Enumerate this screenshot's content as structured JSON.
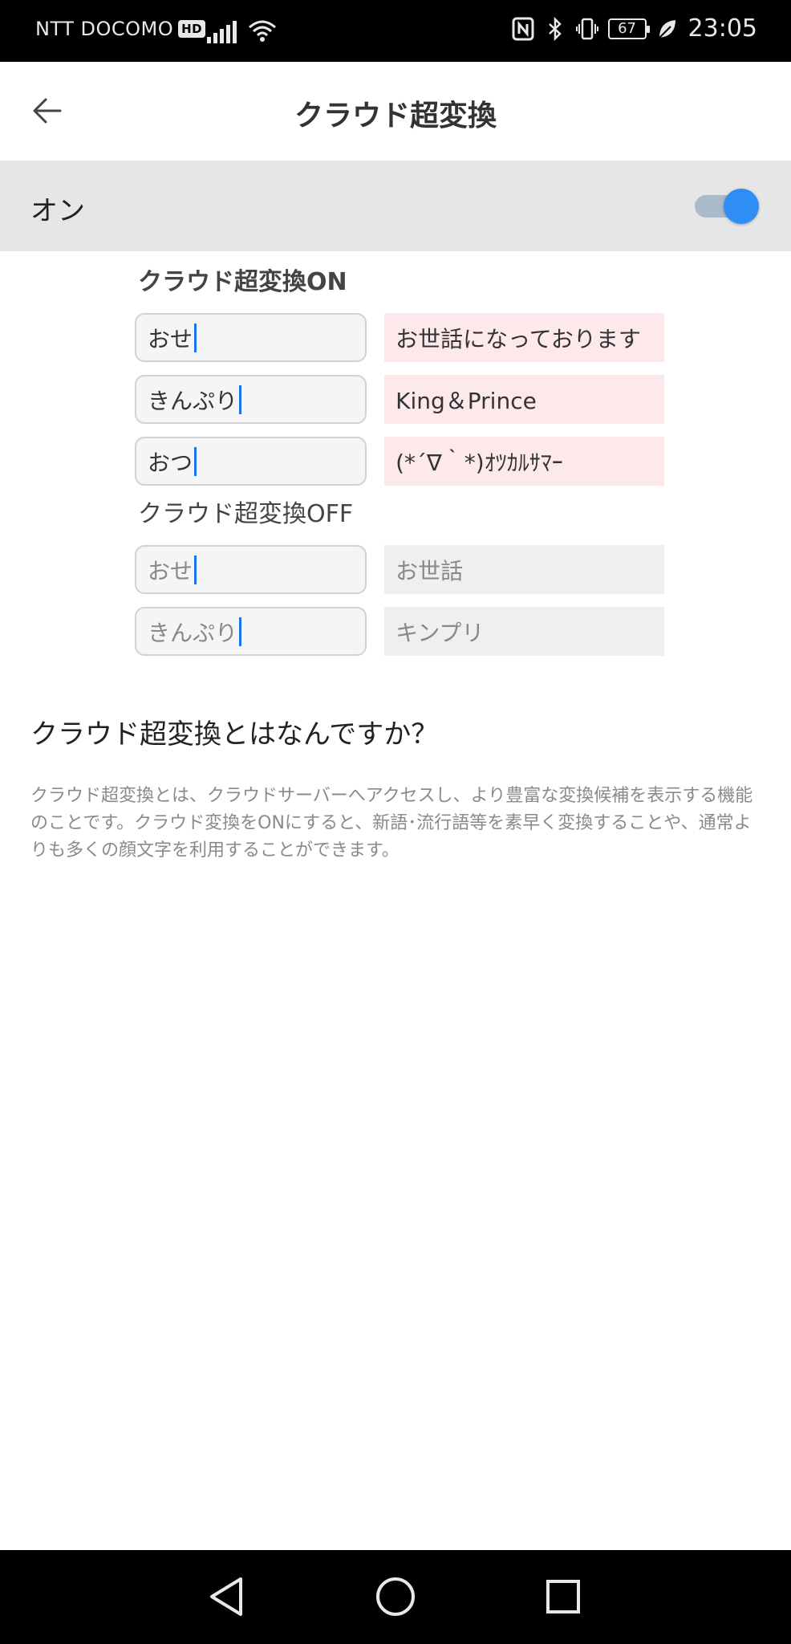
{
  "status_bar": {
    "carrier": "NTT DOCOMO",
    "hd_badge": "HD",
    "battery": "67",
    "time": "23:05"
  },
  "app_bar": {
    "title": "クラウド超変換",
    "back_icon": "arrow-left-icon"
  },
  "toggle": {
    "label": "オン",
    "state": "on",
    "accent_color": "#2f8ef5"
  },
  "demo": {
    "on_heading": "クラウド超変換ON",
    "on_rows": [
      {
        "input": "おせ",
        "result": "お世話になっております"
      },
      {
        "input": "きんぷり",
        "result": "King＆Prince"
      },
      {
        "input": "おつ",
        "result": "(*´∇｀*)ｵﾂｶﾙｻﾏｰ"
      }
    ],
    "off_heading": "クラウド超変換OFF",
    "off_rows": [
      {
        "input": "おせ",
        "result": "お世話"
      },
      {
        "input": "きんぷり",
        "result": "キンプリ"
      }
    ],
    "on_result_bg": "#fde8eb",
    "off_result_bg": "#efefef"
  },
  "faq": {
    "title": "クラウド超変換とはなんですか？",
    "body": "クラウド超変換とは、クラウドサーバーへアクセスし、より豊富な変換候補を表示する機能のことです。クラウド変換をONにすると、新語･流行語等を素早く変換することや、通常よりも多くの顔文字を利用することができます。"
  },
  "nav_bar": {
    "back": "triangle-back-icon",
    "home": "circle-home-icon",
    "recents": "square-recents-icon"
  }
}
